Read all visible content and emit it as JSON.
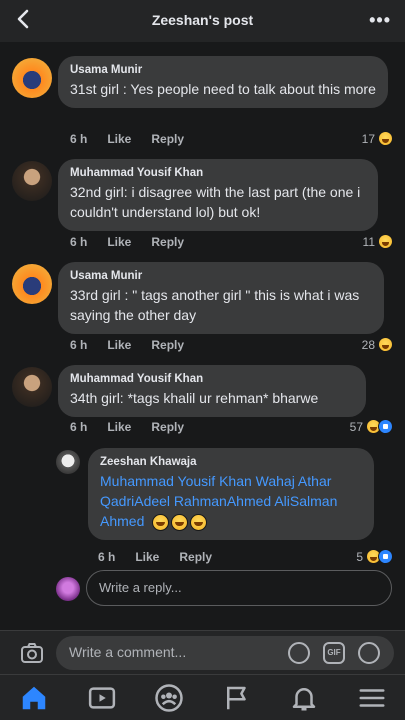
{
  "header": {
    "title": "Zeeshan's post"
  },
  "comments": [
    {
      "author": "Usama Munir",
      "text": "31st girl : Yes people need to talk about this more",
      "time": "6 h",
      "like": "Like",
      "reply": "Reply",
      "reactions": "17"
    },
    {
      "author": "Muhammad Yousif Khan",
      "text": "32nd girl: i disagree with the last part (the one i couldn't understand lol) but ok!",
      "time": "6 h",
      "like": "Like",
      "reply": "Reply",
      "reactions": "11"
    },
    {
      "author": "Usama Munir",
      "text": "33rd girl : \" tags another girl \" this is what i was saying the other day",
      "time": "6 h",
      "like": "Like",
      "reply": "Reply",
      "reactions": "28"
    },
    {
      "author": "Muhammad Yousif Khan",
      "text": "34th girl: *tags khalil ur rehman* bharwe",
      "time": "6 h",
      "like": "Like",
      "reply": "Reply",
      "reactions": "57"
    }
  ],
  "nested_reply": {
    "author": "Zeeshan Khawaja",
    "mentions": "Muhammad Yousif Khan Wahaj Athar QadriAdeel RahmanAhmed AliSalman Ahmed",
    "time": "6 h",
    "like": "Like",
    "reply": "Reply",
    "reactions": "5"
  },
  "reply_box": {
    "placeholder": "Write a reply..."
  },
  "composer": {
    "placeholder": "Write a comment..."
  },
  "icons": {
    "back": "back-arrow-icon",
    "more": "more-dots-icon",
    "camera": "camera-icon",
    "sticker": "sticker-icon",
    "gif": "gif-icon",
    "emoji": "emoji-icon",
    "tabs": [
      "home-icon",
      "video-icon",
      "groups-icon",
      "flag-icon",
      "bell-icon",
      "menu-icon"
    ]
  },
  "colors": {
    "accent": "#2d86ff",
    "mention": "#4599ff",
    "bubble": "#3a3b3c",
    "background": "#18191a"
  }
}
